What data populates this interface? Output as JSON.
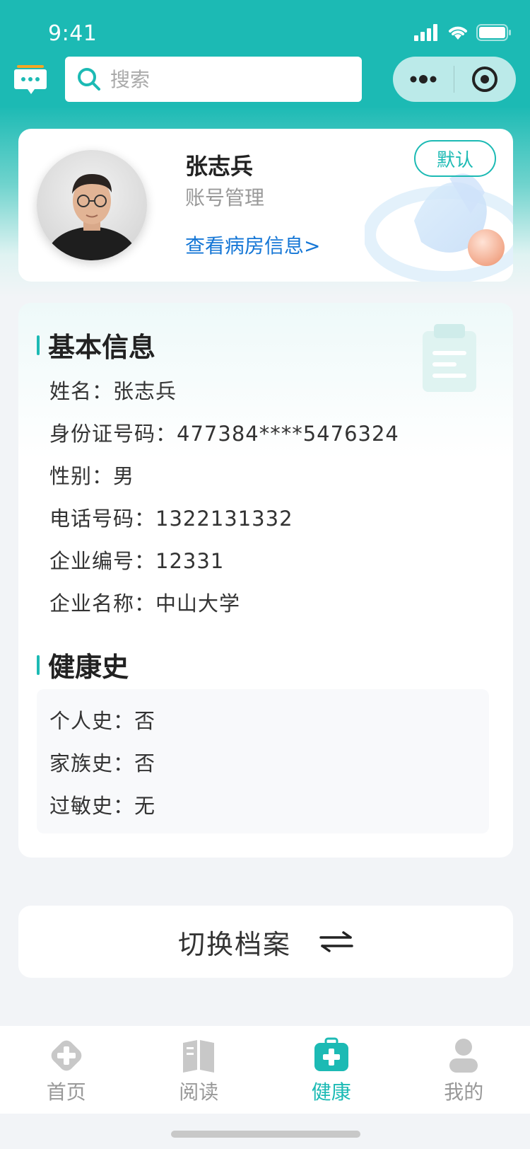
{
  "status_bar": {
    "time": "9:41"
  },
  "nav": {
    "search_placeholder": "搜索"
  },
  "profile": {
    "name": "张志兵",
    "account_mgmt": "账号管理",
    "ward_link": "查看病房信息>",
    "default_badge": "默认"
  },
  "basic_info": {
    "title": "基本信息",
    "rows": [
      {
        "label": "姓名：",
        "value": "张志兵"
      },
      {
        "label": "身份证号码：",
        "value": "477384****5476324"
      },
      {
        "label": "性别：",
        "value": "男"
      },
      {
        "label": "电话号码：",
        "value": "1322131332"
      },
      {
        "label": "企业编号：",
        "value": "12331"
      },
      {
        "label": "企业名称：",
        "value": "中山大学"
      }
    ]
  },
  "health_history": {
    "title": "健康史",
    "rows": [
      {
        "label": "个人史：",
        "value": "否"
      },
      {
        "label": "家族史：",
        "value": "否"
      },
      {
        "label": "过敏史：",
        "value": "无"
      }
    ]
  },
  "switch_button": {
    "label": "切换档案",
    "icon": "swap-arrows-icon"
  },
  "tabbar": {
    "active": "健康",
    "items": [
      {
        "label": "首页",
        "icon": "home-cross-icon"
      },
      {
        "label": "阅读",
        "icon": "book-icon"
      },
      {
        "label": "健康",
        "icon": "medical-kit-icon"
      },
      {
        "label": "我的",
        "icon": "person-icon"
      }
    ]
  },
  "colors": {
    "accent": "#1cbab4",
    "link": "#1677d6",
    "background": "#f2f4f7"
  }
}
